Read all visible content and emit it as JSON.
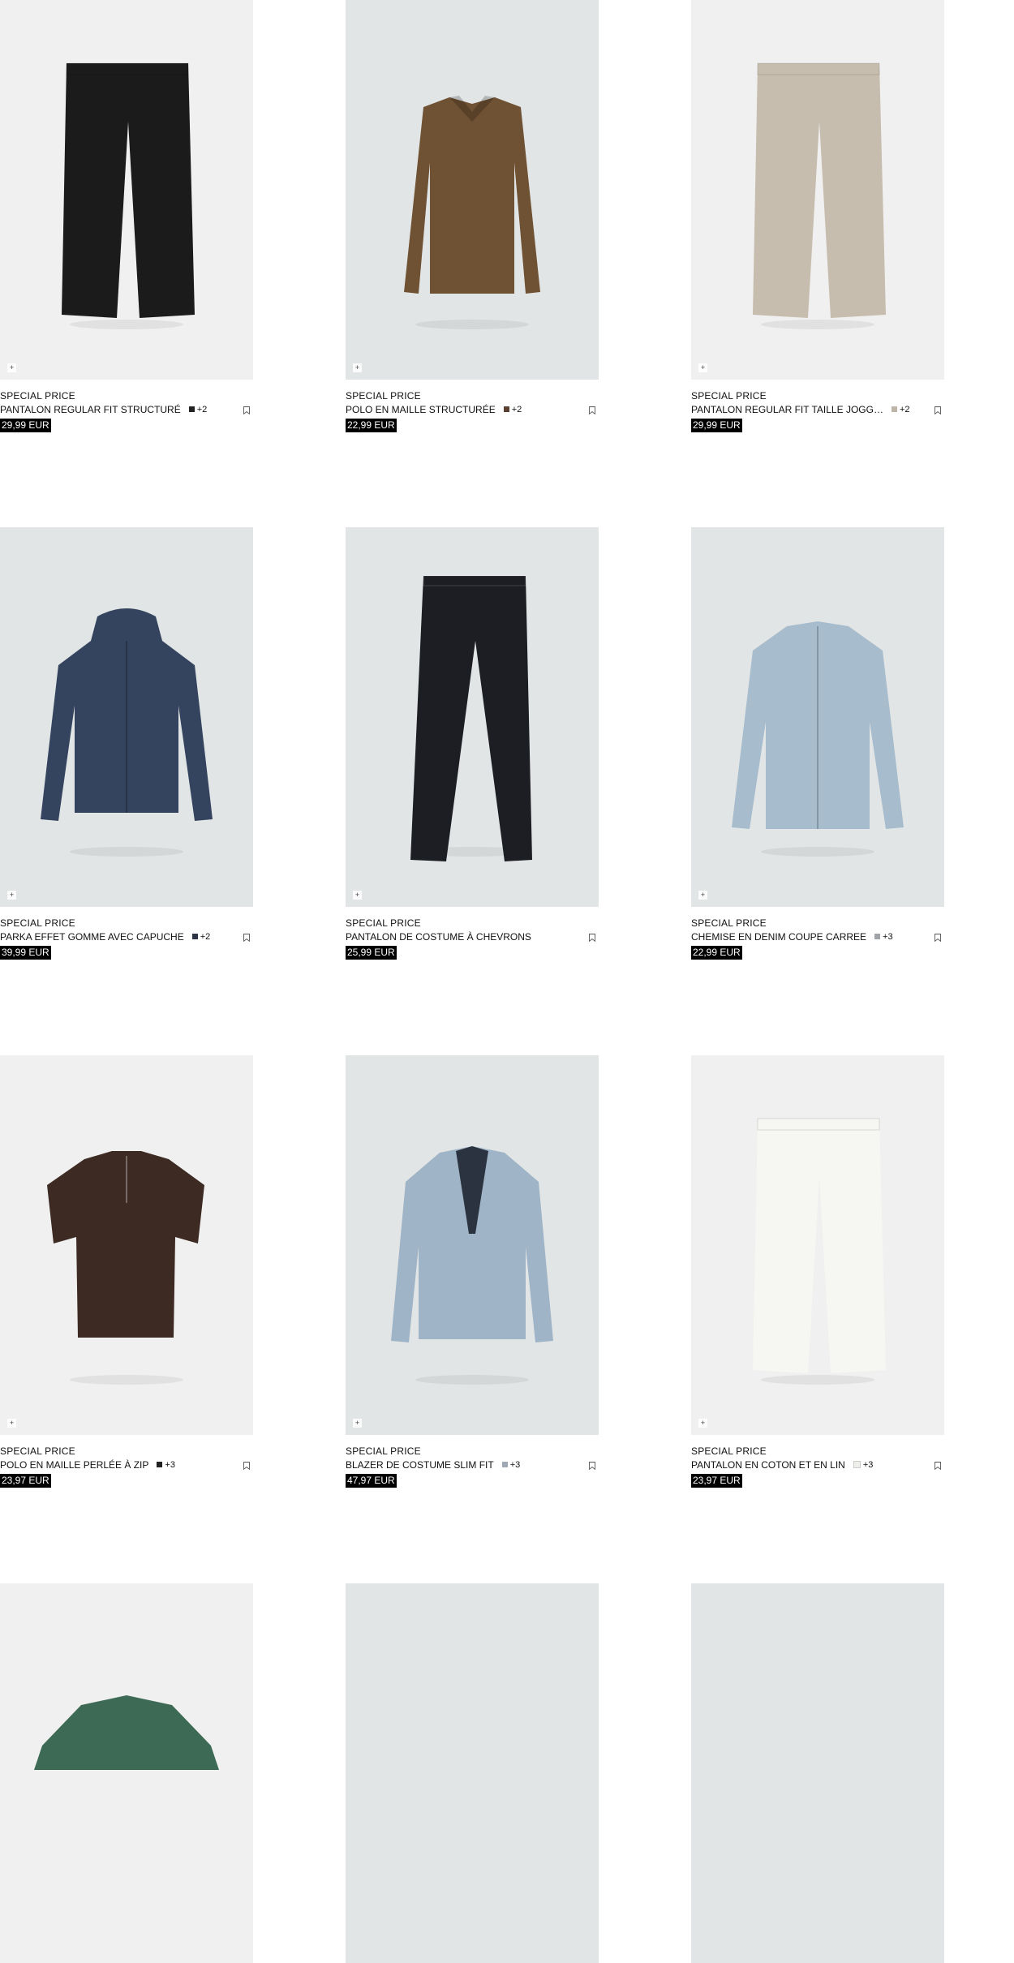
{
  "products": [
    {
      "tag": "SPECIAL PRICE",
      "name": "PANTALON REGULAR FIT STRUCTURÉ",
      "swatch_color": "#222222",
      "more": "+2",
      "price": "29,99 EUR",
      "bg": "#f0f0f0",
      "garment": "trousers",
      "garment_color": "#1b1b1b"
    },
    {
      "tag": "SPECIAL PRICE",
      "name": "POLO EN MAILLE STRUCTURÉE",
      "swatch_color": "#5a4030",
      "more": "+2",
      "price": "22,99 EUR",
      "bg": "#e2e5e6",
      "garment": "longsleeve-polo",
      "garment_color": "#6f5233"
    },
    {
      "tag": "SPECIAL PRICE",
      "name": "PANTALON REGULAR FIT TAILLE JOGG…",
      "swatch_color": "#bdb6a8",
      "more": "+2",
      "price": "29,99 EUR",
      "bg": "#f0f0f0",
      "garment": "trousers",
      "garment_color": "#c7bdae"
    },
    {
      "tag": "SPECIAL PRICE",
      "name": "PARKA EFFET GOMME AVEC CAPUCHE",
      "swatch_color": "#2d3445",
      "more": "+2",
      "price": "39,99 EUR",
      "bg": "#e2e5e6",
      "garment": "parka",
      "garment_color": "#34445f"
    },
    {
      "tag": "SPECIAL PRICE",
      "name": "PANTALON DE COSTUME À CHEVRONS",
      "swatch_color": "",
      "more": "",
      "price": "25,99 EUR",
      "bg": "#e2e5e6",
      "garment": "slim-trousers",
      "garment_color": "#1d1d24"
    },
    {
      "tag": "SPECIAL PRICE",
      "name": "CHEMISE EN DENIM COUPE CARREE",
      "swatch_color": "#a0a4a8",
      "more": "+3",
      "price": "22,99 EUR",
      "bg": "#e2e5e6",
      "garment": "shirt",
      "garment_color": "#a7bccd"
    },
    {
      "tag": "SPECIAL PRICE",
      "name": "POLO EN MAILLE PERLÉE À ZIP",
      "swatch_color": "#222222",
      "more": "+3",
      "price": "23,97 EUR",
      "bg": "#f0f0f0",
      "garment": "polo",
      "garment_color": "#3d2a22"
    },
    {
      "tag": "SPECIAL PRICE",
      "name": "BLAZER DE COSTUME SLIM FIT",
      "swatch_color": "#9fa9b3",
      "more": "+3",
      "price": "47,97 EUR",
      "bg": "#e2e5e6",
      "garment": "blazer",
      "garment_color": "#9fb4c6"
    },
    {
      "tag": "SPECIAL PRICE",
      "name": "PANTALON EN COTON ET EN LIN",
      "swatch_color": "#eeeeea",
      "more": "+3",
      "price": "23,97 EUR",
      "bg": "#f0f0f0",
      "garment": "trousers",
      "garment_color": "#f6f6f2"
    },
    {
      "tag": "",
      "name": "",
      "swatch_color": "",
      "more": "",
      "price": "",
      "bg": "#f0f0f0",
      "garment": "jacket-partial",
      "garment_color": "#3c6a55"
    },
    {
      "tag": "",
      "name": "",
      "swatch_color": "",
      "more": "",
      "price": "",
      "bg": "#e2e5e6",
      "garment": "none",
      "garment_color": ""
    },
    {
      "tag": "",
      "name": "",
      "swatch_color": "",
      "more": "",
      "price": "",
      "bg": "#e2e5e6",
      "garment": "none",
      "garment_color": ""
    }
  ],
  "icons": {
    "add": "plus-icon",
    "save": "bookmark-icon"
  }
}
